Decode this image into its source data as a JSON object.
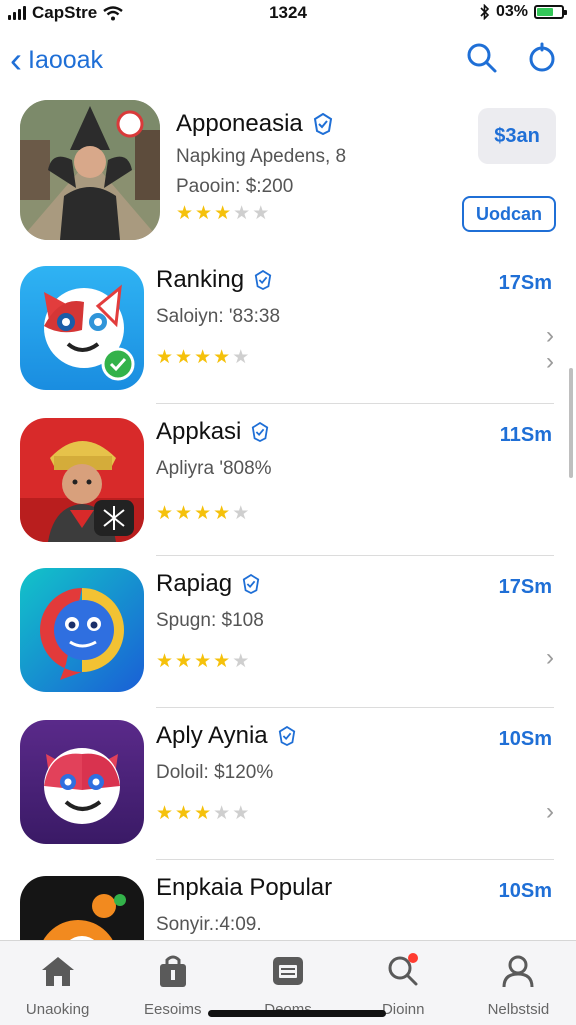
{
  "status_bar": {
    "carrier": "CapStre",
    "time": "1324",
    "battery": "03%"
  },
  "nav": {
    "back_label": "Iaooak"
  },
  "featured": {
    "name": "Apponeasia",
    "subtitle": "Napking Apedens, 8",
    "detail": "Paooin: $:200",
    "rating": 3,
    "get_label": "$3an",
    "open_label": "Uodcan"
  },
  "apps": [
    {
      "name": "Ranking",
      "subtitle": "Saloiyn: '83:38",
      "rating": 4,
      "price": "17Sm",
      "chevrons": 2
    },
    {
      "name": "Appkasi",
      "subtitle": "Apliyra '808%",
      "rating": 4,
      "price": "11Sm",
      "chevrons": 0
    },
    {
      "name": "Rapiag",
      "subtitle": "Spugn: $108",
      "rating": 4,
      "price": "17Sm",
      "chevrons": 1
    },
    {
      "name": "Aply Aynia",
      "subtitle": "Doloil: $120%",
      "rating": 3,
      "price": "10Sm",
      "chevrons": 1
    },
    {
      "name": "Enpkaia Popular",
      "subtitle": "Sonyir.:4:09.",
      "rating": 0,
      "price": "10Sm",
      "chevrons": 0
    }
  ],
  "tabs": [
    {
      "label": "Unaoking",
      "icon": "home-icon"
    },
    {
      "label": "Eesoims",
      "icon": "bag-icon"
    },
    {
      "label": "Deoms",
      "icon": "document-icon"
    },
    {
      "label": "Dioinn",
      "icon": "search-icon",
      "badge": true
    },
    {
      "label": "Nelbstsid",
      "icon": "person-icon"
    }
  ],
  "colors": {
    "accent": "#1f6fd6",
    "star": "#f5c10b",
    "badge": "#ff3b30"
  }
}
